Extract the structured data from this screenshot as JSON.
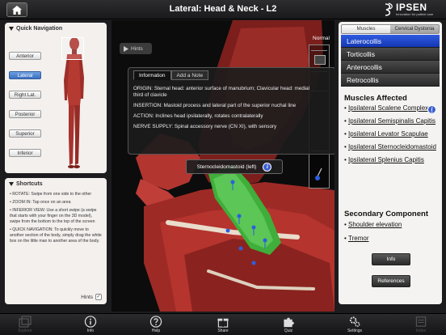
{
  "header": {
    "title": "Lateral: Head & Neck - L2",
    "logo": "IPSEN",
    "logo_sub": "Innovation for patient care"
  },
  "quick_nav": {
    "title": "Quick Navigation",
    "buttons": [
      {
        "label": "Anterior",
        "active": false
      },
      {
        "label": "Lateral",
        "active": true
      },
      {
        "label": "Right Lat.",
        "active": false
      },
      {
        "label": "Posterior",
        "active": false
      },
      {
        "label": "Superior",
        "active": false
      },
      {
        "label": "Inferior",
        "active": false
      }
    ]
  },
  "shortcuts": {
    "title": "Shortcuts",
    "items": [
      "• ROTATE: Swipe from one side to the other",
      "• ZOOM IN: Tap once on an area",
      "• INFERIOR VIEW: Use a short swipe (a swipe that starts with your finger on the 3D model), swipe from the bottom to the top of the screen",
      "• QUICK NAVIGATION: To quickly move to another section of the body, simply drag the white box on the little man to another area of the body."
    ],
    "hints_label": "Hints",
    "hints_checked": true
  },
  "viewer": {
    "hints_button": "Hints",
    "view_mode": "Normal",
    "tabs": [
      "Information",
      "Add a Note"
    ],
    "info": {
      "origin": "ORIGIN:  Sternal head: anterior surface of manubrium; Clavicular head: medial third of clavicle",
      "insertion": "INSERTION:  Mastoid process and lateral part of the superior nuchal line",
      "action": "ACTION:  Inclines head ipsilaterally, rotates contralaterally",
      "nerve": "NERVE SUPPLY:  Spinal accessory nerve (CN XI), with sensory"
    },
    "selected_muscle": "Sternocleidomastoid (left)"
  },
  "right_panel": {
    "tabs": [
      "Muscles",
      "Cervical Dystonia"
    ],
    "active_tab": 1,
    "conditions": [
      "Laterocollis",
      "Torticollis",
      "Anterocollis",
      "Retrocollis"
    ],
    "active_condition": 0,
    "muscles_title": "Muscles Affected",
    "muscles": [
      "Ipsilateral Scalene Complex",
      "Ipsilateral Semispinalis Capitis",
      "Ipsilateral Levator Scapulae",
      "Ipsilateral Sternocleidomastoid",
      "Ipsilateral Splenius Capitis"
    ],
    "secondary_title": "Secondary Component",
    "secondary": [
      "Shoulder elevation",
      "Tremor"
    ],
    "info_button": "Info",
    "references_button": "References"
  },
  "toolbar": {
    "items": [
      {
        "label": "Explore",
        "icon": "stack-icon",
        "enabled": false
      },
      {
        "label": "Info",
        "icon": "info-icon",
        "enabled": true
      },
      {
        "label": "Help",
        "icon": "help-icon",
        "enabled": true
      },
      {
        "label": "Share",
        "icon": "gift-icon",
        "enabled": true
      },
      {
        "label": "Quiz",
        "icon": "puzzle-icon",
        "enabled": true
      },
      {
        "label": "Settings",
        "icon": "gear-icon",
        "enabled": true
      },
      {
        "label": "Index",
        "icon": "list-icon",
        "enabled": false
      }
    ]
  },
  "colors": {
    "accent": "#1f47c8",
    "muscle_highlight": "#3fae3a",
    "muscle_red": "#b22a25"
  }
}
